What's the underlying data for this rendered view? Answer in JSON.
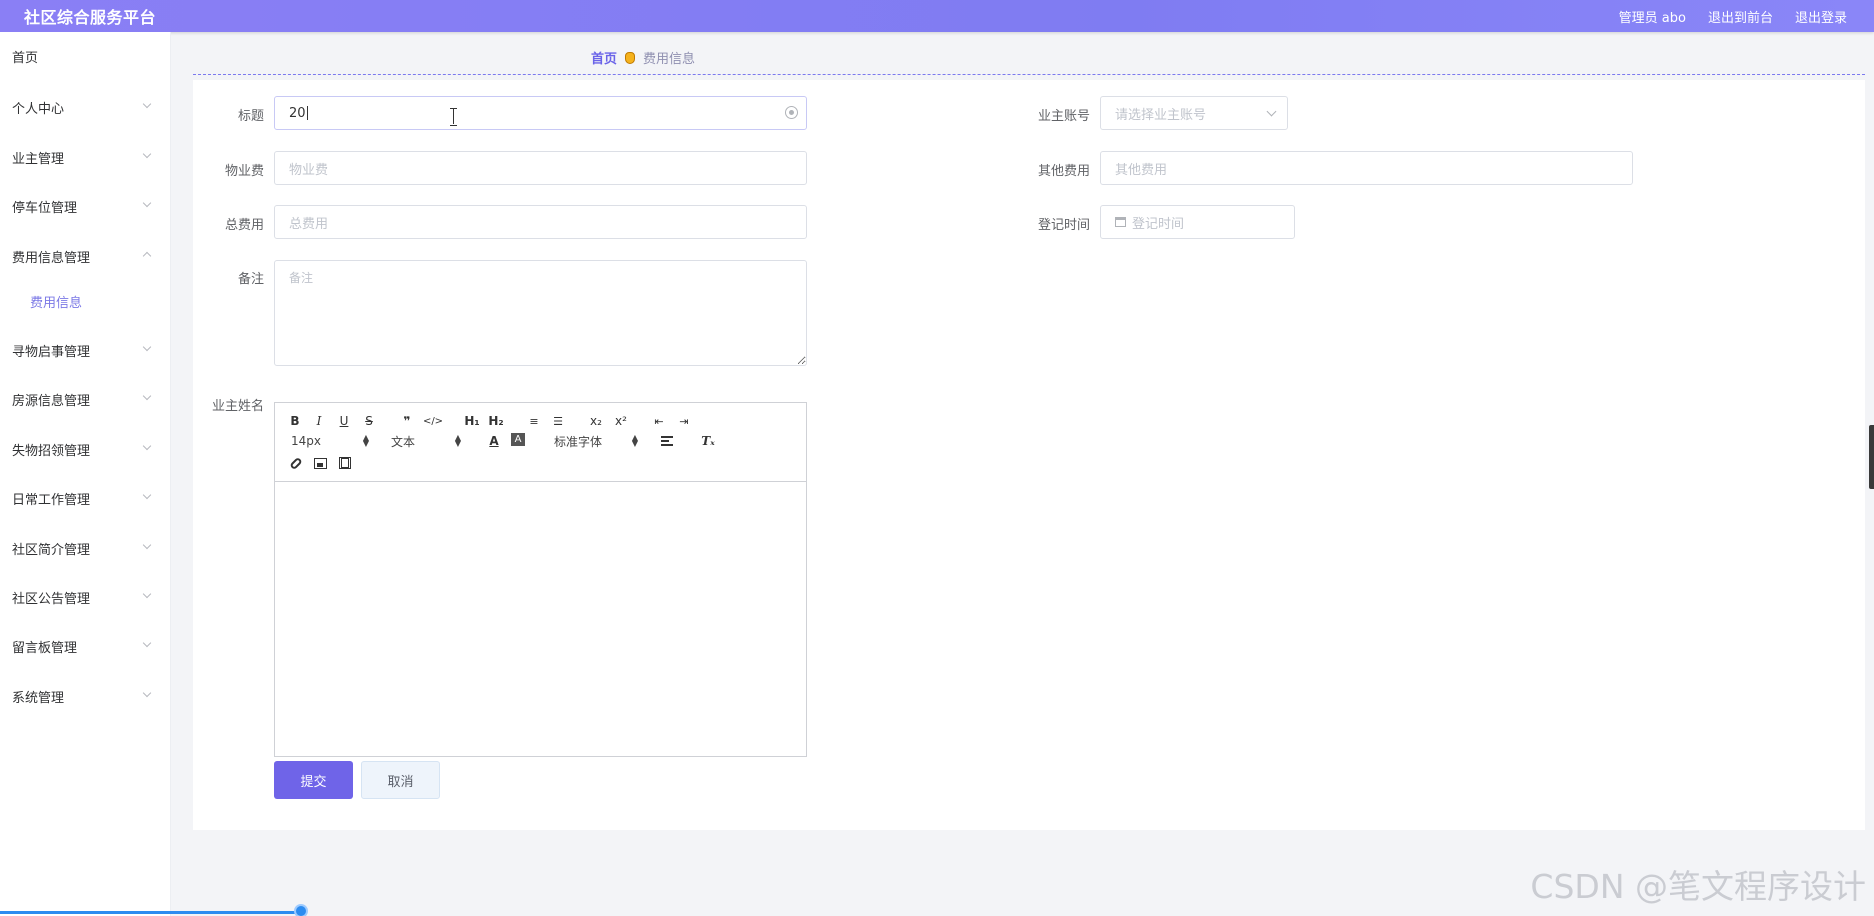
{
  "header": {
    "title": "社区综合服务平台",
    "admin_label": "管理员 abo",
    "front_link": "退出到前台",
    "logout_link": "退出登录"
  },
  "sidebar": {
    "items": [
      {
        "label": "首页",
        "has_arrow": false
      },
      {
        "label": "个人中心",
        "has_arrow": true
      },
      {
        "label": "业主管理",
        "has_arrow": true
      },
      {
        "label": "停车位管理",
        "has_arrow": true
      },
      {
        "label": "费用信息管理",
        "has_arrow": true,
        "expanded": true
      },
      {
        "label": "寻物启事管理",
        "has_arrow": true
      },
      {
        "label": "房源信息管理",
        "has_arrow": true
      },
      {
        "label": "失物招领管理",
        "has_arrow": true
      },
      {
        "label": "日常工作管理",
        "has_arrow": true
      },
      {
        "label": "社区简介管理",
        "has_arrow": true
      },
      {
        "label": "社区公告管理",
        "has_arrow": true
      },
      {
        "label": "留言板管理",
        "has_arrow": true
      },
      {
        "label": "系统管理",
        "has_arrow": true
      }
    ],
    "sub_item": "费用信息"
  },
  "breadcrumb": {
    "home": "首页",
    "current": "费用信息"
  },
  "form": {
    "title_label": "标题",
    "title_value": "20",
    "owner_account_label": "业主账号",
    "owner_account_placeholder": "请选择业主账号",
    "property_fee_label": "物业费",
    "property_fee_placeholder": "物业费",
    "other_fee_label": "其他费用",
    "other_fee_placeholder": "其他费用",
    "total_fee_label": "总费用",
    "total_fee_placeholder": "总费用",
    "register_time_label": "登记时间",
    "register_time_placeholder": "登记时间",
    "notes_label": "备注",
    "notes_placeholder": "备注",
    "owner_name_label": "业主姓名"
  },
  "editor": {
    "size_select": "14px",
    "text_select": "文本",
    "font_select": "标准字体",
    "h1": "H₁",
    "h2": "H₂",
    "sub": "x₂",
    "sup": "x²",
    "quote": "❞",
    "code": "</>",
    "clear_format": "Tₓ"
  },
  "buttons": {
    "submit": "提交",
    "cancel": "取消"
  },
  "watermark": "CSDN @笔文程序设计"
}
